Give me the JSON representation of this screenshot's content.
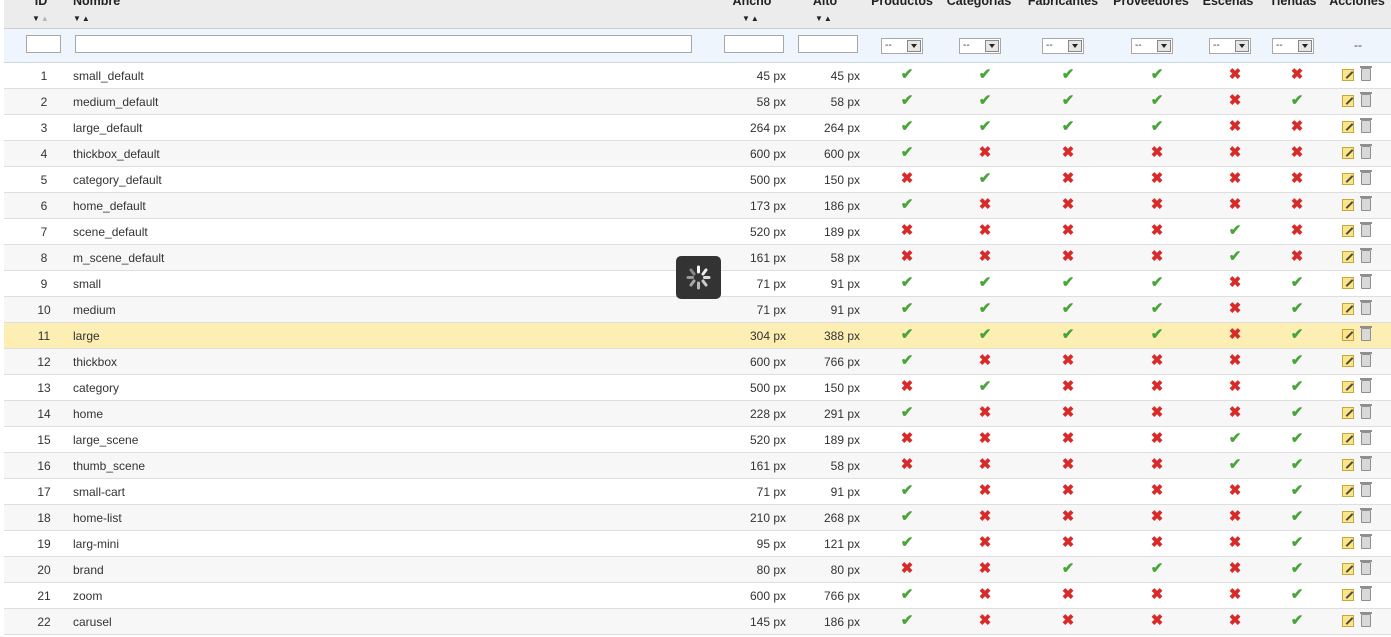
{
  "columns": {
    "id": "ID",
    "name": "Nombre",
    "width": "Ancho",
    "height": "Alto",
    "products": "Productos",
    "categories": "Categorías",
    "manufacturers": "Fabricantes",
    "suppliers": "Proveedores",
    "scenes": "Escenas",
    "stores": "Tiendas",
    "actions": "Acciones"
  },
  "filters": {
    "select_value": "--",
    "actions_value": "--"
  },
  "flag_colors": {
    "yes": "#49a53a",
    "no": "#d92a2a"
  },
  "rows": [
    {
      "id": "1",
      "name": "small_default",
      "width": "45 px",
      "height": "45 px",
      "products": true,
      "categories": true,
      "manufacturers": true,
      "suppliers": true,
      "scenes": false,
      "stores": false
    },
    {
      "id": "2",
      "name": "medium_default",
      "width": "58 px",
      "height": "58 px",
      "products": true,
      "categories": true,
      "manufacturers": true,
      "suppliers": true,
      "scenes": false,
      "stores": true
    },
    {
      "id": "3",
      "name": "large_default",
      "width": "264 px",
      "height": "264 px",
      "products": true,
      "categories": true,
      "manufacturers": true,
      "suppliers": true,
      "scenes": false,
      "stores": false
    },
    {
      "id": "4",
      "name": "thickbox_default",
      "width": "600 px",
      "height": "600 px",
      "products": true,
      "categories": false,
      "manufacturers": false,
      "suppliers": false,
      "scenes": false,
      "stores": false
    },
    {
      "id": "5",
      "name": "category_default",
      "width": "500 px",
      "height": "150 px",
      "products": false,
      "categories": true,
      "manufacturers": false,
      "suppliers": false,
      "scenes": false,
      "stores": false
    },
    {
      "id": "6",
      "name": "home_default",
      "width": "173 px",
      "height": "186 px",
      "products": true,
      "categories": false,
      "manufacturers": false,
      "suppliers": false,
      "scenes": false,
      "stores": false
    },
    {
      "id": "7",
      "name": "scene_default",
      "width": "520 px",
      "height": "189 px",
      "products": false,
      "categories": false,
      "manufacturers": false,
      "suppliers": false,
      "scenes": true,
      "stores": false
    },
    {
      "id": "8",
      "name": "m_scene_default",
      "width": "161 px",
      "height": "58 px",
      "products": false,
      "categories": false,
      "manufacturers": false,
      "suppliers": false,
      "scenes": true,
      "stores": false
    },
    {
      "id": "9",
      "name": "small",
      "width": "71 px",
      "height": "91 px",
      "products": true,
      "categories": true,
      "manufacturers": true,
      "suppliers": true,
      "scenes": false,
      "stores": true
    },
    {
      "id": "10",
      "name": "medium",
      "width": "71 px",
      "height": "91 px",
      "products": true,
      "categories": true,
      "manufacturers": true,
      "suppliers": true,
      "scenes": false,
      "stores": true
    },
    {
      "id": "11",
      "name": "large",
      "width": "304 px",
      "height": "388 px",
      "products": true,
      "categories": true,
      "manufacturers": true,
      "suppliers": true,
      "scenes": false,
      "stores": true,
      "highlighted": true
    },
    {
      "id": "12",
      "name": "thickbox",
      "width": "600 px",
      "height": "766 px",
      "products": true,
      "categories": false,
      "manufacturers": false,
      "suppliers": false,
      "scenes": false,
      "stores": true
    },
    {
      "id": "13",
      "name": "category",
      "width": "500 px",
      "height": "150 px",
      "products": false,
      "categories": true,
      "manufacturers": false,
      "suppliers": false,
      "scenes": false,
      "stores": true
    },
    {
      "id": "14",
      "name": "home",
      "width": "228 px",
      "height": "291 px",
      "products": true,
      "categories": false,
      "manufacturers": false,
      "suppliers": false,
      "scenes": false,
      "stores": true
    },
    {
      "id": "15",
      "name": "large_scene",
      "width": "520 px",
      "height": "189 px",
      "products": false,
      "categories": false,
      "manufacturers": false,
      "suppliers": false,
      "scenes": true,
      "stores": true
    },
    {
      "id": "16",
      "name": "thumb_scene",
      "width": "161 px",
      "height": "58 px",
      "products": false,
      "categories": false,
      "manufacturers": false,
      "suppliers": false,
      "scenes": true,
      "stores": true
    },
    {
      "id": "17",
      "name": "small-cart",
      "width": "71 px",
      "height": "91 px",
      "products": true,
      "categories": false,
      "manufacturers": false,
      "suppliers": false,
      "scenes": false,
      "stores": true
    },
    {
      "id": "18",
      "name": "home-list",
      "width": "210 px",
      "height": "268 px",
      "products": true,
      "categories": false,
      "manufacturers": false,
      "suppliers": false,
      "scenes": false,
      "stores": true
    },
    {
      "id": "19",
      "name": "larg-mini",
      "width": "95 px",
      "height": "121 px",
      "products": true,
      "categories": false,
      "manufacturers": false,
      "suppliers": false,
      "scenes": false,
      "stores": true
    },
    {
      "id": "20",
      "name": "brand",
      "width": "80 px",
      "height": "80 px",
      "products": false,
      "categories": false,
      "manufacturers": true,
      "suppliers": true,
      "scenes": false,
      "stores": true
    },
    {
      "id": "21",
      "name": "zoom",
      "width": "600 px",
      "height": "766 px",
      "products": true,
      "categories": false,
      "manufacturers": false,
      "suppliers": false,
      "scenes": false,
      "stores": true
    },
    {
      "id": "22",
      "name": "carusel",
      "width": "145 px",
      "height": "186 px",
      "products": true,
      "categories": false,
      "manufacturers": false,
      "suppliers": false,
      "scenes": false,
      "stores": true
    }
  ]
}
